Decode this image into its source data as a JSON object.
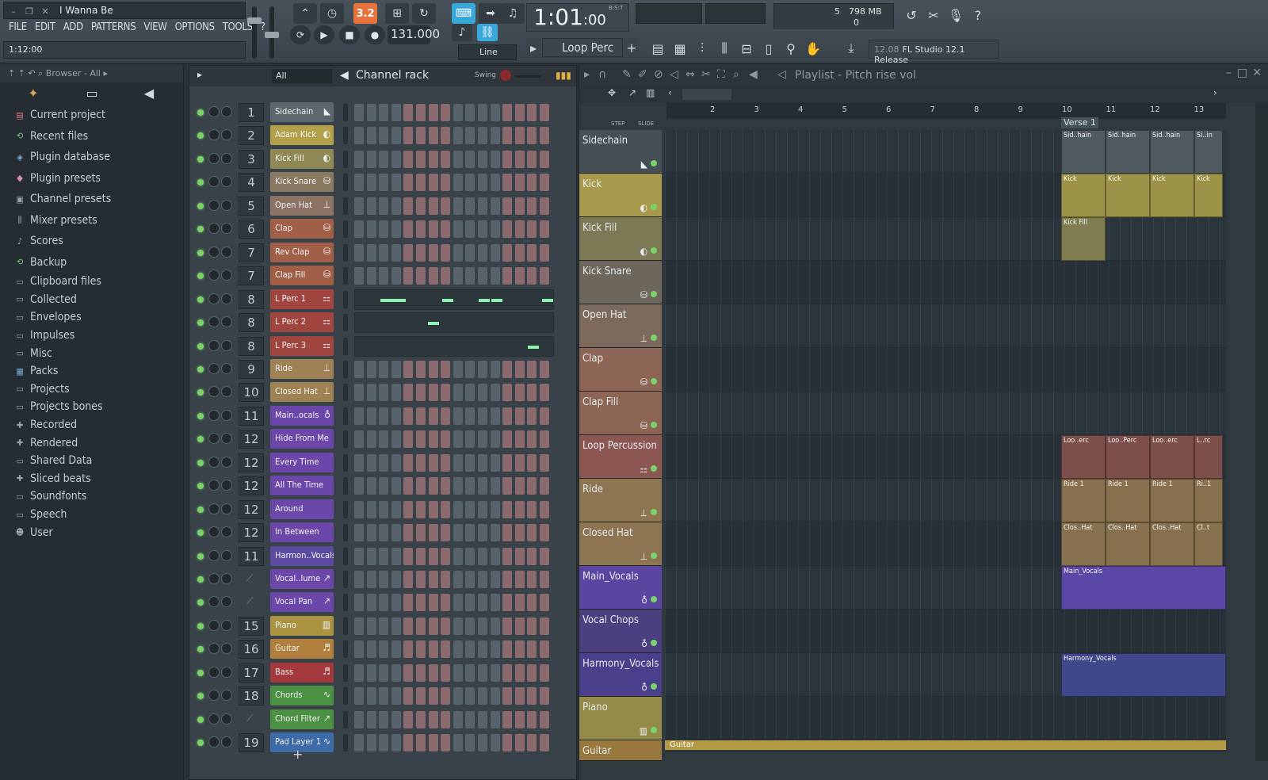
{
  "title_bar": {
    "song": "I Wanna Be",
    "hint": "1:12:00"
  },
  "menu": [
    "FILE",
    "EDIT",
    "ADD",
    "PATTERNS",
    "VIEW",
    "OPTIONS",
    "TOOLS",
    "?"
  ],
  "toolbar": {
    "pattern_song_mode": "3.2",
    "tempo": "131.000",
    "time": "1:01",
    "time_sub": ":00",
    "time_unit": "B:S:T",
    "snap": "Line",
    "pattern": "Loop Perc",
    "cpu_value": "5",
    "memory": "798 MB",
    "poly": "0",
    "news_version": "12.08",
    "news_text": "FL Studio 12.1 Release"
  },
  "browser": {
    "header": "Browser - All",
    "items": [
      {
        "label": "Current project",
        "icon": "project-icon"
      },
      {
        "label": "Recent files",
        "icon": "recent-icon"
      },
      {
        "label": "Plugin database",
        "icon": "plugin-db-icon"
      },
      {
        "label": "Plugin presets",
        "icon": "plugin-preset-icon"
      },
      {
        "label": "Channel presets",
        "icon": "channel-preset-icon"
      },
      {
        "label": "Mixer presets",
        "icon": "mixer-preset-icon"
      },
      {
        "label": "Scores",
        "icon": "score-icon"
      },
      {
        "label": "Backup",
        "icon": "backup-icon"
      },
      {
        "label": "Clipboard files",
        "icon": "folder-icon"
      },
      {
        "label": "Collected",
        "icon": "folder-icon"
      },
      {
        "label": "Envelopes",
        "icon": "folder-icon"
      },
      {
        "label": "Impulses",
        "icon": "folder-icon"
      },
      {
        "label": "Misc",
        "icon": "folder-icon"
      },
      {
        "label": "Packs",
        "icon": "packs-icon"
      },
      {
        "label": "Projects",
        "icon": "folder-icon"
      },
      {
        "label": "Projects bones",
        "icon": "folder-icon"
      },
      {
        "label": "Recorded",
        "icon": "recorded-icon"
      },
      {
        "label": "Rendered",
        "icon": "rendered-icon"
      },
      {
        "label": "Shared Data",
        "icon": "folder-icon"
      },
      {
        "label": "Sliced beats",
        "icon": "sliced-icon"
      },
      {
        "label": "Soundfonts",
        "icon": "folder-icon"
      },
      {
        "label": "Speech",
        "icon": "folder-icon"
      },
      {
        "label": "User",
        "icon": "user-icon"
      }
    ]
  },
  "channel_rack": {
    "title": "Channel rack",
    "filter": "All",
    "swing_label": "Swing",
    "channels": [
      {
        "num": "1",
        "name": "Sidechain",
        "color": "#5c676d",
        "icon": "envelope-icon"
      },
      {
        "num": "2",
        "name": "Adam Kick",
        "color": "#b2a14a",
        "icon": "audio-clip-icon"
      },
      {
        "num": "3",
        "name": "Kick Fill",
        "color": "#8f8a55",
        "icon": "audio-clip-icon"
      },
      {
        "num": "4",
        "name": "Kick Snare",
        "color": "#8a7a62",
        "icon": "drum-icon"
      },
      {
        "num": "5",
        "name": "Open Hat",
        "color": "#8c7364",
        "icon": "hat-icon"
      },
      {
        "num": "6",
        "name": "Clap",
        "color": "#a15f48",
        "icon": "drum-icon"
      },
      {
        "num": "7",
        "name": "Rev Clap",
        "color": "#a15f48",
        "icon": "drum-icon"
      },
      {
        "num": "7",
        "name": "Clap Fill",
        "color": "#a15f48",
        "icon": "drum-icon"
      },
      {
        "num": "8",
        "name": "L Perc 1",
        "color": "#a1463f",
        "icon": "perc-icon"
      },
      {
        "num": "8",
        "name": "L Perc 2",
        "color": "#a1463f",
        "icon": "perc-icon"
      },
      {
        "num": "8",
        "name": "L Perc 3",
        "color": "#a1463f",
        "icon": "perc-icon"
      },
      {
        "num": "9",
        "name": "Ride",
        "color": "#9e8253",
        "icon": "hat-icon"
      },
      {
        "num": "10",
        "name": "Closed Hat",
        "color": "#9e8253",
        "icon": "hat-icon"
      },
      {
        "num": "11",
        "name": "Main..ocals",
        "color": "#6a47a8",
        "icon": "vocal-icon"
      },
      {
        "num": "12",
        "name": "Hide From Me",
        "color": "#6a47a8",
        "icon": ""
      },
      {
        "num": "12",
        "name": "Every Time",
        "color": "#6a47a8",
        "icon": ""
      },
      {
        "num": "12",
        "name": "All The Time",
        "color": "#6a47a8",
        "icon": ""
      },
      {
        "num": "12",
        "name": "Around",
        "color": "#6a47a8",
        "icon": ""
      },
      {
        "num": "12",
        "name": "In Between",
        "color": "#6a47a8",
        "icon": ""
      },
      {
        "num": "11",
        "name": "Harmon..Vocals",
        "color": "#5b4aa0",
        "icon": ""
      },
      {
        "num": "",
        "name": "Vocal..lume",
        "color": "#6a47a8",
        "icon": "automation-icon"
      },
      {
        "num": "",
        "name": "Vocal Pan",
        "color": "#6a47a8",
        "icon": "automation-icon"
      },
      {
        "num": "15",
        "name": "Piano",
        "color": "#a99341",
        "icon": "piano-icon"
      },
      {
        "num": "16",
        "name": "Guitar",
        "color": "#b07f3d",
        "icon": "guitar-icon"
      },
      {
        "num": "17",
        "name": "Bass",
        "color": "#a3393c",
        "icon": "guitar-icon"
      },
      {
        "num": "18",
        "name": "Chords",
        "color": "#4c9043",
        "icon": "synth-icon"
      },
      {
        "num": "",
        "name": "Chord Filter",
        "color": "#4c9043",
        "icon": "automation-icon"
      },
      {
        "num": "19",
        "name": "Pad Layer 1",
        "color": "#3f6aa8",
        "icon": "synth-icon"
      }
    ]
  },
  "playlist": {
    "title": "Playlist - Pitch rise vol",
    "step_label": "STEP",
    "slide_label": "SLIDE",
    "bars": [
      "2",
      "3",
      "4",
      "5",
      "6",
      "7",
      "8",
      "9",
      "10",
      "11",
      "12",
      "13"
    ],
    "marker": "Verse 1",
    "tracks": [
      {
        "name": "Sidechain",
        "color": "#454f55",
        "icon": "envelope-icon",
        "clips": [
          "Sid..hain",
          "Sid..hain",
          "Sid..hain",
          "Si..in"
        ],
        "clip_color": "#4f5a60"
      },
      {
        "name": "Kick",
        "color": "#a89a4c",
        "icon": "audio-clip-icon",
        "clips": [
          "Kick",
          "Kick",
          "Kick",
          "Kick"
        ],
        "clip_color": "#9c9248"
      },
      {
        "name": "Kick Fill",
        "color": "#7c7a55",
        "icon": "audio-clip-icon",
        "clips": [
          "Kick Fill"
        ],
        "clip_color": "#7f7d50"
      },
      {
        "name": "Kick Snare",
        "color": "#6c665b",
        "icon": "drum-icon",
        "clips": [],
        "clip_color": ""
      },
      {
        "name": "Open Hat",
        "color": "#7d6a5e",
        "icon": "hat-icon",
        "clips": [],
        "clip_color": ""
      },
      {
        "name": "Clap",
        "color": "#8d6554",
        "icon": "drum-icon",
        "clips": [],
        "clip_color": ""
      },
      {
        "name": "Clap Fill",
        "color": "#8d6554",
        "icon": "drum-icon",
        "clips": [],
        "clip_color": ""
      },
      {
        "name": "Loop Percussion",
        "color": "#8c5651",
        "icon": "perc-icon",
        "clips": [
          "Loo..erc",
          "Loo..Perc",
          "Loo..erc",
          "L..rc"
        ],
        "clip_color": "#7c4f4a"
      },
      {
        "name": "Ride",
        "color": "#8d7552",
        "icon": "hat-icon",
        "clips": [
          "Ride 1",
          "Ride 1",
          "Ride 1",
          "Ri..1"
        ],
        "clip_color": "#86704e"
      },
      {
        "name": "Closed Hat",
        "color": "#8d7552",
        "icon": "hat-icon",
        "clips": [
          "Clos..Hat",
          "Clos..Hat",
          "Clos..Hat",
          "Cl..t"
        ],
        "clip_color": "#86704e"
      },
      {
        "name": "Main_Vocals",
        "color": "#5a45a0",
        "icon": "vocal-icon",
        "clips": [
          "Main_Vocals"
        ],
        "clip_color": "#5a47a6"
      },
      {
        "name": "Vocal Chops",
        "color": "#4b3f80",
        "icon": "vocal-icon",
        "clips": [],
        "clip_color": ""
      },
      {
        "name": "Harmony_Vocals",
        "color": "#4a3f8a",
        "icon": "vocal-icon",
        "clips": [
          "Harmony_Vocals"
        ],
        "clip_color": "#40478a"
      },
      {
        "name": "Piano",
        "color": "#958a48",
        "icon": "piano-icon",
        "clips": [],
        "clip_color": ""
      },
      {
        "name": "Guitar",
        "color": "#98783e",
        "icon": "guitar-icon",
        "clips": [
          "Guitar"
        ],
        "clip_color": "#b59a45"
      }
    ]
  }
}
